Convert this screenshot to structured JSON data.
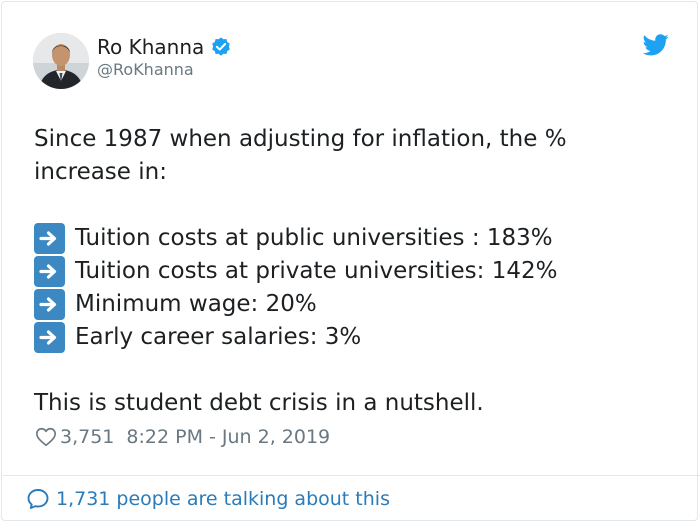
{
  "author": {
    "name": "Ro Khanna",
    "handle": "@RoKhanna"
  },
  "tweet": {
    "intro": "Since 1987 when adjusting for inflation, the % increase in:",
    "items": [
      "Tuition costs at public universities : 183%",
      "Tuition costs at private universities: 142%",
      "Minimum wage: 20%",
      "Early career salaries: 3%"
    ],
    "outro": "This is student debt crisis in a nutshell."
  },
  "meta": {
    "likes": "3,751",
    "timestamp": "8:22 PM - Jun 2, 2019"
  },
  "footer": {
    "talking": "1,731 people are talking about this"
  },
  "colors": {
    "verified_blue": "#1da1f2",
    "link_blue": "#2b7bb9",
    "arrow_emoji_bg": "#3b88c3",
    "meta_gray": "#697882"
  },
  "icons": {
    "verified": "verified-badge-icon",
    "logo": "twitter-bird-icon",
    "arrow": "right-arrow-emoji-icon",
    "like": "heart-icon",
    "reply": "speech-bubble-icon"
  }
}
